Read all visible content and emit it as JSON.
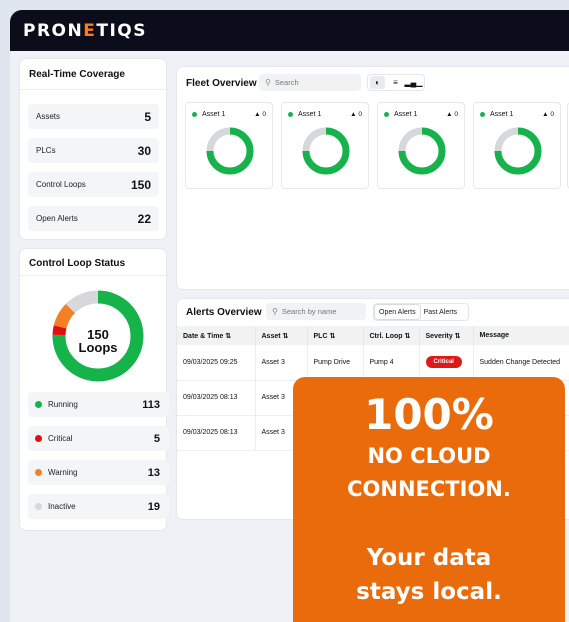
{
  "brand": {
    "logo_prefix": "PRON",
    "logo_mid": "E",
    "logo_suffix": "TIQS"
  },
  "coverage": {
    "title": "Real-Time Coverage",
    "items": [
      {
        "label": "Assets",
        "value": "5"
      },
      {
        "label": "PLCs",
        "value": "30"
      },
      {
        "label": "Control Loops",
        "value": "150"
      },
      {
        "label": "Open Alerts",
        "value": "22"
      }
    ]
  },
  "loop_status": {
    "title": "Control Loop Status",
    "center_value": "150",
    "center_label": "Loops",
    "items": [
      {
        "label": "Running",
        "value": "113",
        "count": 113,
        "color": "#16b24a"
      },
      {
        "label": "Critical",
        "value": "5",
        "count": 5,
        "color": "#e01010"
      },
      {
        "label": "Warning",
        "value": "13",
        "count": 13,
        "color": "#f57f25"
      },
      {
        "label": "Inactive",
        "value": "19",
        "count": 19,
        "color": "#d6d8dc"
      }
    ]
  },
  "fleet": {
    "title": "Fleet Overview",
    "search_placeholder": "Search",
    "views": [
      "grid-view-icon",
      "list-view-icon",
      "bar-chart-icon"
    ],
    "assets": [
      {
        "name": "Asset 1",
        "alerts": "0",
        "running_fraction": 0.75
      },
      {
        "name": "Asset 1",
        "alerts": "0",
        "running_fraction": 0.75
      },
      {
        "name": "Asset 1",
        "alerts": "0",
        "running_fraction": 0.75
      },
      {
        "name": "Asset 1",
        "alerts": "0",
        "running_fraction": 0.75
      }
    ]
  },
  "alerts": {
    "title": "Alerts Overview",
    "search_placeholder": "Search by name",
    "tabs": [
      "Open Alerts",
      "Past Alerts"
    ],
    "columns": [
      "Date & Time  ⇅",
      "Asset  ⇅",
      "PLC  ⇅",
      "Ctrl. Loop  ⇅",
      "Severity  ⇅",
      "Message"
    ],
    "rows": [
      {
        "date": "09/03/2025 09:25",
        "asset": "Asset 3",
        "plc": "Pump Drive",
        "loop": "Pump 4",
        "severity": "Critical",
        "message": "Sudden Change Detected"
      },
      {
        "date": "09/03/2025 08:13",
        "asset": "Asset 3",
        "plc": "",
        "loop": "",
        "severity": "",
        "message": ""
      },
      {
        "date": "09/03/2025 08:13",
        "asset": "Asset 3",
        "plc": "",
        "loop": "",
        "severity": "",
        "message": ""
      }
    ]
  },
  "promo": {
    "big": "100%",
    "line1": "NO CLOUD",
    "line2": "CONNECTION.",
    "line3": "Your data",
    "line4": "stays local."
  }
}
